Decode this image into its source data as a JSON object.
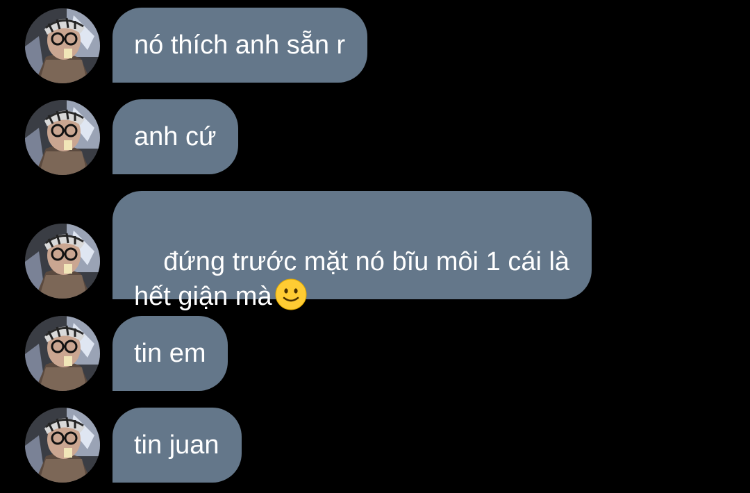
{
  "messages": [
    {
      "text": "nó thích anh sẵn r",
      "emoji": ""
    },
    {
      "text": "anh cứ",
      "emoji": ""
    },
    {
      "text": "đứng trước mặt nó bĩu môi 1 cái là\nhết giận mà",
      "emoji": "slightly-smiling-face-icon"
    },
    {
      "text": "tin em",
      "emoji": ""
    },
    {
      "text": "tin juan",
      "emoji": ""
    }
  ],
  "colors": {
    "background": "#000000",
    "bubble": "#64778a",
    "text": "#ffffff"
  }
}
